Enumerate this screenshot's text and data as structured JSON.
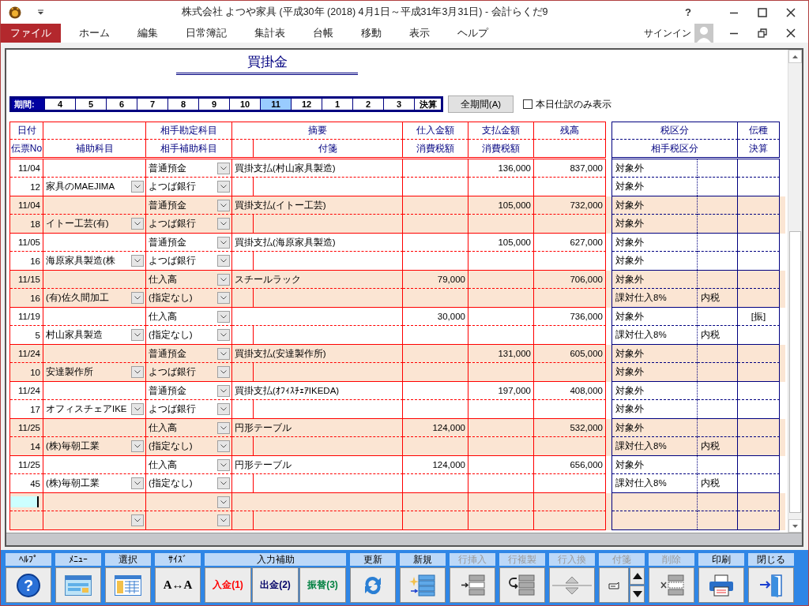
{
  "window": {
    "title": "株式会社 よつや家具 (平成30年 (2018) 4月1日～平成31年3月31日) - 会計らくだ9",
    "help": "?"
  },
  "menu": [
    {
      "label": "ファイル",
      "selected": true
    },
    {
      "label": "ホーム",
      "selected": false
    },
    {
      "label": "編集",
      "selected": false
    },
    {
      "label": "日常簿記",
      "selected": false
    },
    {
      "label": "集計表",
      "selected": false
    },
    {
      "label": "台帳",
      "selected": false
    },
    {
      "label": "移動",
      "selected": false
    },
    {
      "label": "表示",
      "selected": false
    },
    {
      "label": "ヘルプ",
      "selected": false
    }
  ],
  "account": {
    "sign_in": "サインイン"
  },
  "ledger": {
    "title": "買掛金",
    "period_label": "期間:",
    "periods": [
      {
        "label": "4",
        "selected": false
      },
      {
        "label": "5",
        "selected": false
      },
      {
        "label": "6",
        "selected": false
      },
      {
        "label": "7",
        "selected": false
      },
      {
        "label": "8",
        "selected": false
      },
      {
        "label": "9",
        "selected": false
      },
      {
        "label": "10",
        "selected": false
      },
      {
        "label": "11",
        "selected": true
      },
      {
        "label": "12",
        "selected": false
      },
      {
        "label": "1",
        "selected": false
      },
      {
        "label": "2",
        "selected": false
      },
      {
        "label": "3",
        "selected": false
      },
      {
        "label": "決算",
        "selected": false
      }
    ],
    "all_periods_button": "全期間(A)",
    "today_only": {
      "label": "本日仕訳のみ表示",
      "checked": false
    },
    "columns": {
      "date": "日付",
      "slip_no": "伝票No",
      "sub_account": "補助科目",
      "counter_account": "相手勘定科目",
      "counter_sub_account": "相手補助科目",
      "memo": "摘要",
      "tag": "付箋",
      "purchase": "仕入金額",
      "purchase_tax": "消費税額",
      "payment": "支払金額",
      "payment_tax": "消費税額",
      "balance": "残高",
      "tax_class": "税区分",
      "counter_tax_class": "相手税区分",
      "voucher_type": "伝種",
      "closing": "決算"
    },
    "entries": [
      {
        "date": "11/04",
        "slip_no": "12",
        "sub_account": "家具のMAEJIMA",
        "counter_account": "普通預金",
        "counter_sub_account": "よつば銀行",
        "memo": "買掛支払(村山家具製造)",
        "payment": "136,000",
        "balance": "837,000",
        "tax_class": "対象外",
        "counter_tax_class": "対象外"
      },
      {
        "date": "11/04",
        "slip_no": "18",
        "sub_account": "イトー工芸(有)",
        "counter_account": "普通預金",
        "counter_sub_account": "よつば銀行",
        "memo": "買掛支払(イトー工芸)",
        "payment": "105,000",
        "balance": "732,000",
        "tax_class": "対象外",
        "counter_tax_class": "対象外"
      },
      {
        "date": "11/05",
        "slip_no": "16",
        "sub_account": "海原家具製造(株",
        "counter_account": "普通預金",
        "counter_sub_account": "よつば銀行",
        "memo": "買掛支払(海原家具製造)",
        "payment": "105,000",
        "balance": "627,000",
        "tax_class": "対象外",
        "counter_tax_class": "対象外"
      },
      {
        "date": "11/15",
        "slip_no": "16",
        "sub_account": "(有)佐久間加工",
        "counter_account": "仕入高",
        "counter_sub_account": "(指定なし)",
        "memo": "スチールラック",
        "purchase": "79,000",
        "balance": "706,000",
        "tax_class": "対象外",
        "counter_tax_class": "課対仕入8%",
        "counter_tax_mode": "内税"
      },
      {
        "date": "11/19",
        "slip_no": "5",
        "sub_account": "村山家具製造",
        "counter_account": "仕入高",
        "counter_sub_account": "(指定なし)",
        "purchase": "30,000",
        "balance": "736,000",
        "tax_class": "対象外",
        "counter_tax_class": "課対仕入8%",
        "counter_tax_mode": "内税",
        "voucher_type": "[振]"
      },
      {
        "date": "11/24",
        "slip_no": "10",
        "sub_account": "安達製作所",
        "counter_account": "普通預金",
        "counter_sub_account": "よつば銀行",
        "memo": "買掛支払(安達製作所)",
        "payment": "131,000",
        "balance": "605,000",
        "tax_class": "対象外",
        "counter_tax_class": "対象外"
      },
      {
        "date": "11/24",
        "slip_no": "17",
        "sub_account": "オフィスチェアIKE",
        "counter_account": "普通預金",
        "counter_sub_account": "よつば銀行",
        "memo": "買掛支払(ｵﾌｨｽﾁｪｱIKEDA)",
        "payment": "197,000",
        "balance": "408,000",
        "tax_class": "対象外",
        "counter_tax_class": "対象外"
      },
      {
        "date": "11/25",
        "slip_no": "14",
        "sub_account": "(株)毎朝工業",
        "counter_account": "仕入高",
        "counter_sub_account": "(指定なし)",
        "memo": "円形テーブル",
        "purchase": "124,000",
        "balance": "532,000",
        "tax_class": "対象外",
        "counter_tax_class": "課対仕入8%",
        "counter_tax_mode": "内税"
      },
      {
        "date": "11/25",
        "slip_no": "45",
        "sub_account": "(株)毎朝工業",
        "counter_account": "仕入高",
        "counter_sub_account": "(指定なし)",
        "memo": "円形テーブル",
        "purchase": "124,000",
        "balance": "656,000",
        "tax_class": "対象外",
        "counter_tax_class": "課対仕入8%",
        "counter_tax_mode": "内税"
      }
    ]
  },
  "toolbar": [
    {
      "label": "ﾍﾙﾌﾟ",
      "kind": "help",
      "disabled": false,
      "icon_text": "?"
    },
    {
      "label": "ﾒﾆｭｰ",
      "kind": "menu",
      "disabled": false
    },
    {
      "label": "選択",
      "kind": "select",
      "disabled": false
    },
    {
      "label": "ｻｲｽﾞ",
      "kind": "size",
      "disabled": false,
      "icon_text": "A↔A"
    },
    {
      "label": "入力補助",
      "kind": "input_assist",
      "disabled": false,
      "buttons": [
        {
          "label": "入金(1)",
          "color": "#ff0000"
        },
        {
          "label": "出金(2)",
          "color": "#000066"
        },
        {
          "label": "振替(3)",
          "color": "#008040"
        }
      ]
    },
    {
      "label": "更新",
      "kind": "refresh",
      "disabled": false
    },
    {
      "label": "新規",
      "kind": "new",
      "disabled": false
    },
    {
      "label": "行挿入",
      "kind": "insert",
      "disabled": true
    },
    {
      "label": "行複製",
      "kind": "duplicate",
      "disabled": true
    },
    {
      "label": "行入換",
      "kind": "swap",
      "disabled": true
    },
    {
      "label": "付箋",
      "kind": "tag",
      "disabled": true
    },
    {
      "label": "削除",
      "kind": "delete",
      "disabled": true
    },
    {
      "label": "印刷",
      "kind": "print",
      "disabled": false
    },
    {
      "label": "閉じる",
      "kind": "close",
      "disabled": false
    }
  ]
}
